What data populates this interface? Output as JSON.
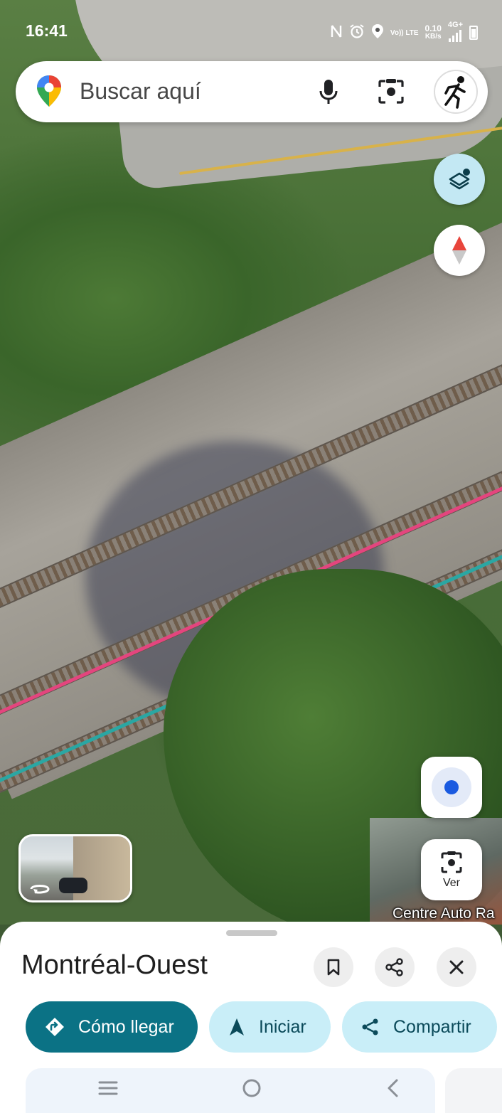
{
  "status_bar": {
    "time": "16:41",
    "volte_label": "Vo)) LTE",
    "data_speed_value": "0.10",
    "data_speed_unit": "KB/s",
    "network_label": "4G+"
  },
  "search": {
    "placeholder": "Buscar aquí"
  },
  "map": {
    "place_label": "Centre Auto Ra",
    "route_colors": [
      "#e4457e",
      "#2aa7a3"
    ]
  },
  "map_controls": {
    "ver_label": "Ver"
  },
  "place_sheet": {
    "title": "Montréal-Ouest",
    "actions": {
      "directions": "Cómo llegar",
      "start": "Iniciar",
      "share": "Compartir"
    }
  },
  "colors": {
    "primary_button": "#0b7285",
    "secondary_button": "#c9eef8",
    "layers_button": "#c3e8f3",
    "location_dot": "#1a5ae0"
  }
}
